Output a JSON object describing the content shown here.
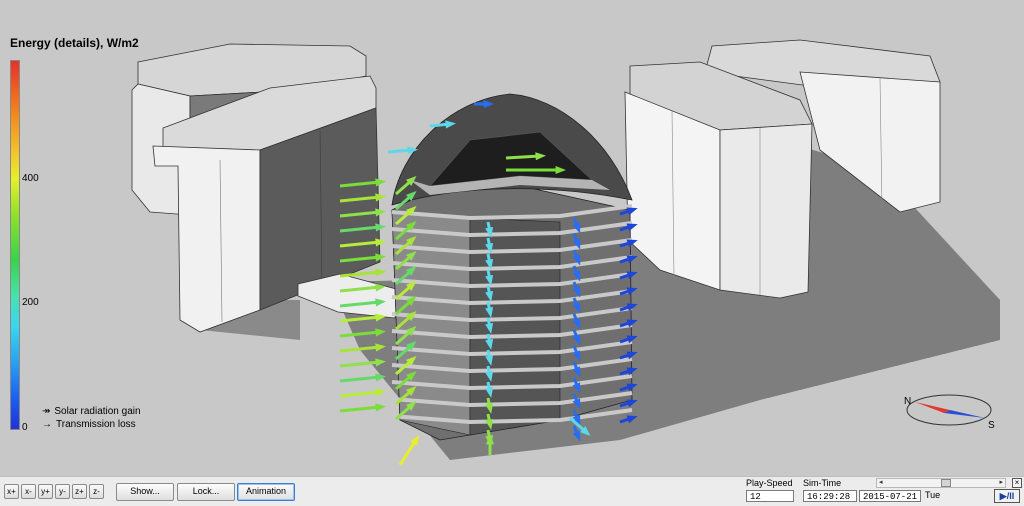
{
  "legend": {
    "title": "Energy (details), W/m2",
    "ticks": [
      "400",
      "200",
      "0"
    ],
    "arrow_keys": [
      "Solar radiation gain",
      "Transmission loss"
    ]
  },
  "compass": {
    "north": "N",
    "south": "S"
  },
  "toolbar": {
    "axis_buttons": [
      "x+",
      "x-",
      "y+",
      "y-",
      "z+",
      "z-"
    ],
    "show_label": "Show...",
    "lock_label": "Lock...",
    "animation_label": "Animation",
    "play_speed_label": "Play-Speed",
    "play_speed_value": "12",
    "sim_time_label": "Sim-Time",
    "sim_time_value": "16:29:28",
    "sim_date_value": "2015-07-21",
    "sim_day_value": "Tue",
    "play_pause_label": "▶/II",
    "close_label": "×"
  },
  "colors": {
    "background": "#c8c8c8",
    "building_light": "#f2f2f2",
    "building_dark": "#5a5a5a",
    "shadow": "#7a7a7a",
    "compass_red": "#e03a2a",
    "compass_blue": "#2a4fd6"
  }
}
